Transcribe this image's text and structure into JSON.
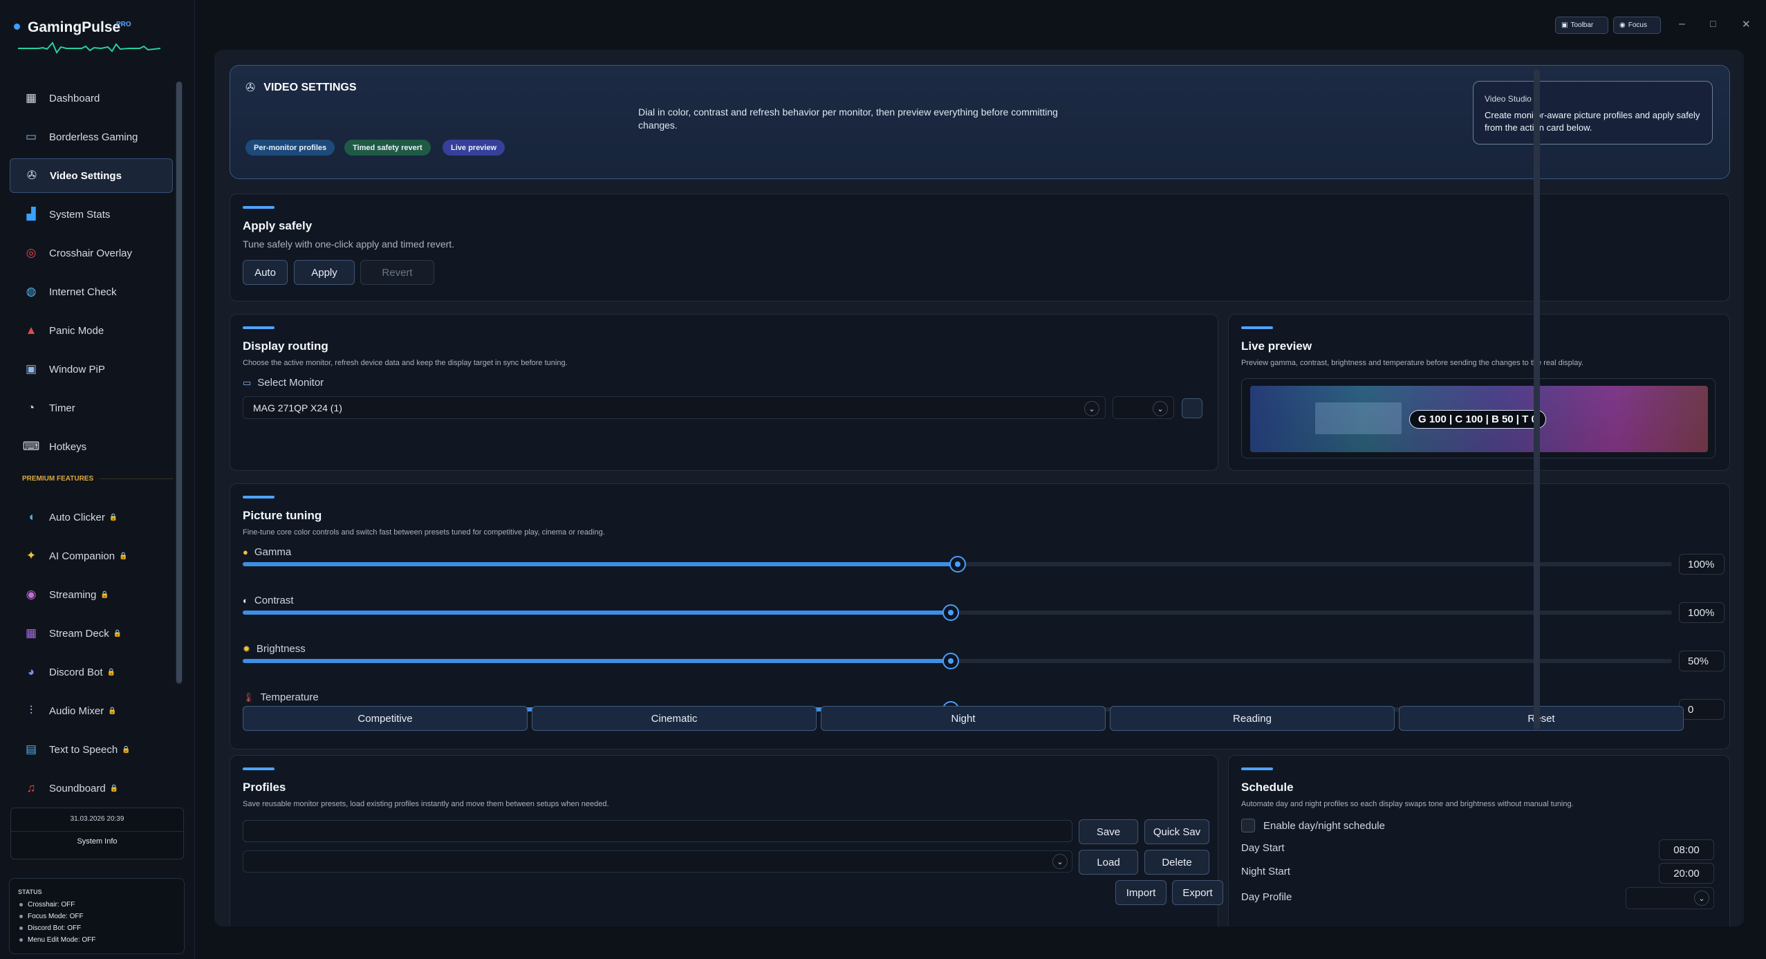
{
  "brand": {
    "name": "GamingPulse",
    "badge": "PRO"
  },
  "sidebar": {
    "items": [
      {
        "label": "Dashboard",
        "icon": "dashboard-icon",
        "glyph": "▦",
        "color": "#cfd7e2"
      },
      {
        "label": "Borderless Gaming",
        "icon": "monitor-icon",
        "glyph": "▭",
        "color": "#8fb7e8"
      },
      {
        "label": "Video Settings",
        "icon": "film-reel-icon",
        "glyph": "✇",
        "color": "#cfd7e2"
      },
      {
        "label": "System Stats",
        "icon": "bar-chart-icon",
        "glyph": "▟",
        "color": "#3aa0ff"
      },
      {
        "label": "Crosshair Overlay",
        "icon": "crosshair-icon",
        "glyph": "◎",
        "color": "#e24a4a"
      },
      {
        "label": "Internet Check",
        "icon": "globe-icon",
        "glyph": "◍",
        "color": "#4fb0e8"
      },
      {
        "label": "Panic Mode",
        "icon": "siren-icon",
        "glyph": "▲",
        "color": "#e24a4a"
      },
      {
        "label": "Window PiP",
        "icon": "pip-icon",
        "glyph": "▣",
        "color": "#8fb7e8"
      },
      {
        "label": "Timer",
        "icon": "stopwatch-icon",
        "glyph": "◔",
        "color": "#cfd7e2"
      },
      {
        "label": "Hotkeys",
        "icon": "keyboard-icon",
        "glyph": "⌨",
        "color": "#cfd7e2"
      }
    ],
    "section_label": "PREMIUM FEATURES",
    "premium": [
      {
        "label": "Auto Clicker",
        "icon": "mouse-icon",
        "glyph": "◖",
        "color": "#4fb0e8"
      },
      {
        "label": "AI Companion",
        "icon": "sparkles-icon",
        "glyph": "✦",
        "color": "#f0c23a"
      },
      {
        "label": "Streaming",
        "icon": "broadcast-icon",
        "glyph": "◉",
        "color": "#c66bd6"
      },
      {
        "label": "Stream Deck",
        "icon": "grid-icon",
        "glyph": "▦",
        "color": "#a56be0"
      },
      {
        "label": "Discord Bot",
        "icon": "discord-icon",
        "glyph": "◕",
        "color": "#7a8cf0"
      },
      {
        "label": "Audio Mixer",
        "icon": "mixer-icon",
        "glyph": "⫶",
        "color": "#8fb7e8"
      },
      {
        "label": "Text to Speech",
        "icon": "speech-icon",
        "glyph": "▤",
        "color": "#4fb0e8"
      },
      {
        "label": "Soundboard",
        "icon": "music-note-icon",
        "glyph": "♫",
        "color": "#e24a4a"
      }
    ],
    "datetime": "31.03.2026 20:39",
    "sysinfo": "System Info",
    "status_title": "STATUS",
    "status": [
      "Crosshair: OFF",
      "Focus Mode: OFF",
      "Discord Bot: OFF",
      "Menu Edit Mode: OFF"
    ]
  },
  "topbar": {
    "toolbar": "Toolbar",
    "focus": "Focus",
    "min": "–",
    "max": "□",
    "close": "✕"
  },
  "hero": {
    "title": "VIDEO SETTINGS",
    "desc": "Dial in color, contrast and refresh behavior per monitor, then preview everything before committing changes.",
    "pills": [
      "Per-monitor profiles",
      "Timed safety revert",
      "Live preview"
    ],
    "studio_label": "Video Studio",
    "studio_text": "Create monitor-aware picture profiles and apply safely from the action card below."
  },
  "apply": {
    "title": "Apply safely",
    "sub": "Tune safely with one-click apply and timed revert.",
    "auto": "Auto",
    "apply": "Apply",
    "revert": "Revert"
  },
  "routing": {
    "title": "Display routing",
    "sub": "Choose the active monitor, refresh device data and keep the display target in sync before tuning.",
    "select_label": "Select Monitor",
    "monitor": "MAG 271QP X24 (1)"
  },
  "preview": {
    "title": "Live preview",
    "sub": "Preview gamma, contrast, brightness and temperature before sending the changes to the real display.",
    "readout": "G 100 | C 100 | B 50 | T 0"
  },
  "tuning": {
    "title": "Picture tuning",
    "sub": "Fine-tune core color controls and switch fast between presets tuned for competitive play, cinema or reading.",
    "sliders": [
      {
        "label": "Gamma",
        "value": "100%",
        "fraction": 0.5,
        "icon": "gamma-icon",
        "glyph": "●",
        "color": "#f0c23a"
      },
      {
        "label": "Contrast",
        "value": "100%",
        "fraction": 0.4955,
        "icon": "contrast-icon",
        "glyph": "◐",
        "color": "#e8eef6"
      },
      {
        "label": "Brightness",
        "value": "50%",
        "fraction": 0.4955,
        "icon": "sun-icon",
        "glyph": "✹",
        "color": "#f0c23a"
      },
      {
        "label": "Temperature",
        "value": "0",
        "fraction": 0.4955,
        "icon": "thermometer-icon",
        "glyph": "🌡",
        "color": "#e24a4a"
      }
    ],
    "presets": [
      "Competitive",
      "Cinematic",
      "Night",
      "Reading",
      "Reset"
    ]
  },
  "profiles": {
    "title": "Profiles",
    "sub": "Save reusable monitor presets, load existing profiles instantly and move them between setups when needed.",
    "save": "Save",
    "quick": "Quick Sav",
    "load": "Load",
    "delete": "Delete",
    "import": "Import",
    "export": "Export"
  },
  "schedule": {
    "title": "Schedule",
    "sub": "Automate day and night profiles so each display swaps tone and brightness without manual tuning.",
    "enable": "Enable day/night schedule",
    "day_start_label": "Day Start",
    "day_start": "08:00",
    "night_start_label": "Night Start",
    "night_start": "20:00",
    "day_profile_label": "Day Profile"
  }
}
